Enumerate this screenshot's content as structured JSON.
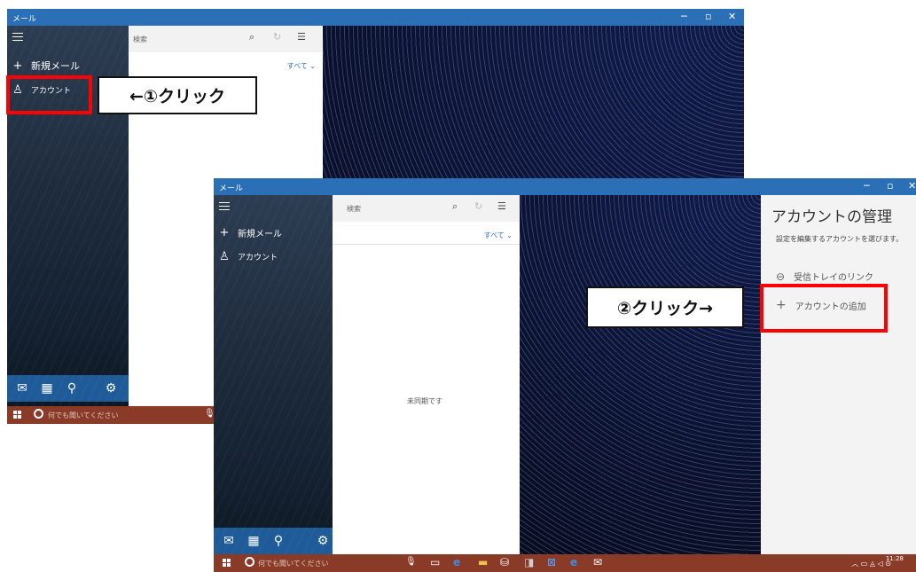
{
  "app_title": "メール",
  "sidebar": {
    "new_mail": "新規メール",
    "accounts": "アカウント"
  },
  "list": {
    "search_label": "検索",
    "filter_label": "すべて ⌄",
    "empty_text": "未同期です"
  },
  "taskbar": {
    "cortana_placeholder": "何でも聞いてください",
    "clock_time": "11:28"
  },
  "account_pane": {
    "title": "アカウントの管理",
    "subtitle": "設定を編集するアカウントを選びます。",
    "linked_inbox": "受信トレイのリンク",
    "add_account": "アカウントの追加"
  },
  "annotations": {
    "step1": "←①クリック",
    "step2": "②クリック→"
  },
  "colors": {
    "titlebar": "#2b6fb6",
    "taskbar": "#8a3b28",
    "highlight": "#ff0000"
  }
}
